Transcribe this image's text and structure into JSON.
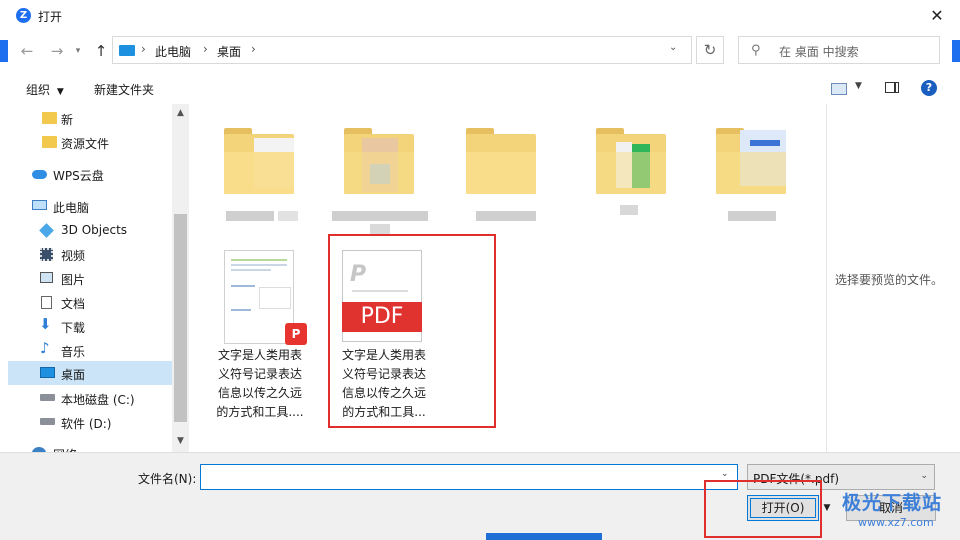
{
  "window": {
    "title": "打开",
    "close_glyph": "✕"
  },
  "address": {
    "back_glyph": "←",
    "forward_glyph": "→",
    "up_glyph": "↑",
    "sep": "›",
    "crumbs": [
      "此电脑",
      "桌面"
    ],
    "refresh_glyph": "↻",
    "search_placeholder": "在 桌面 中搜索"
  },
  "toolbar": {
    "organize_label": "组织",
    "new_folder_label": "新建文件夹",
    "help_glyph": "?"
  },
  "nav": {
    "items": [
      {
        "label": "新",
        "icon": "folder-icon"
      },
      {
        "label": "资源文件",
        "icon": "folder-icon"
      },
      {
        "label": "WPS云盘",
        "icon": "cloud-icon"
      },
      {
        "label": "此电脑",
        "icon": "computer-icon"
      },
      {
        "label": "3D Objects",
        "icon": "cube-icon"
      },
      {
        "label": "视频",
        "icon": "video-icon"
      },
      {
        "label": "图片",
        "icon": "picture-icon"
      },
      {
        "label": "文档",
        "icon": "document-icon"
      },
      {
        "label": "下载",
        "icon": "download-icon"
      },
      {
        "label": "音乐",
        "icon": "music-icon"
      },
      {
        "label": "桌面",
        "icon": "desktop-icon",
        "selected": true
      },
      {
        "label": "本地磁盘 (C:)",
        "icon": "drive-icon"
      },
      {
        "label": "软件 (D:)",
        "icon": "drive-icon"
      },
      {
        "label": "网络",
        "icon": "network-icon"
      }
    ]
  },
  "files": {
    "doc1_name": "文字是人类用表义符号记录表达信息以传之久远的方式和工具....",
    "pdf_name": "文字是人类用表义符号记录表达信息以传之久远的方式和工具...",
    "pdf_badge": "PDF",
    "wps_badge": "P",
    "preview_text": "选择要预览的文件。"
  },
  "bottom": {
    "filename_label": "文件名(N):",
    "filename_value": "",
    "filetype_value": "PDF文件(*.pdf)",
    "open_label": "打开(O)",
    "cancel_label": "取消"
  },
  "watermark": {
    "text": "极光下载站",
    "url": "www.xz7.com"
  },
  "colors": {
    "accent": "#0078d7",
    "highlight_box": "#e02d2d",
    "pdf_red": "#e0322f",
    "selected_nav": "#cce4f7"
  }
}
